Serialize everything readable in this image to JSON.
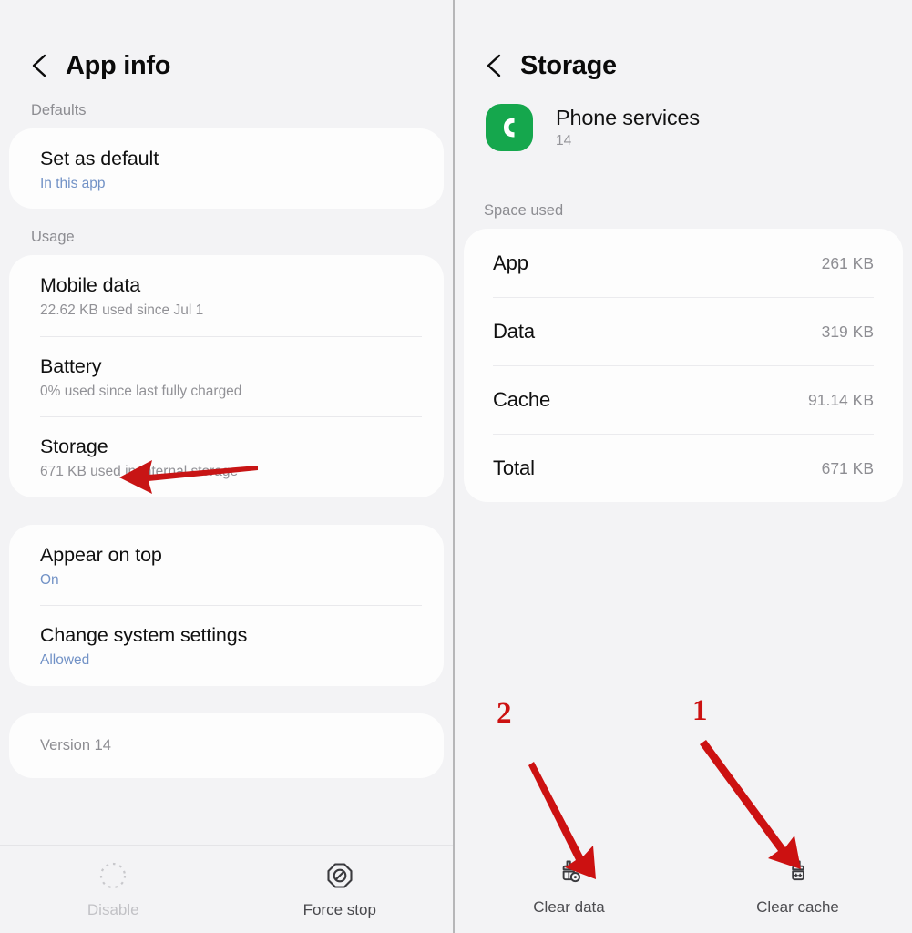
{
  "left_panel": {
    "header": {
      "title": "App info",
      "back_icon": "chevron-left-icon"
    },
    "sections": [
      {
        "label": "Defaults"
      },
      {
        "label": "Usage"
      }
    ],
    "defaults_card": {
      "rows": [
        {
          "title": "Set as default",
          "subtitle": "In this app",
          "subtitle_accent": true
        }
      ]
    },
    "usage_card": {
      "rows": [
        {
          "title": "Mobile data",
          "subtitle": "22.62 KB used since Jul 1",
          "subtitle_accent": false
        },
        {
          "title": "Battery",
          "subtitle": "0% used since last fully charged",
          "subtitle_accent": false
        },
        {
          "title": "Storage",
          "subtitle": "671 KB used in Internal storage",
          "subtitle_accent": false
        }
      ]
    },
    "permissions_card": {
      "rows": [
        {
          "title": "Appear on top",
          "subtitle": "On",
          "subtitle_accent": true
        },
        {
          "title": "Change system settings",
          "subtitle": "Allowed",
          "subtitle_accent": true
        }
      ]
    },
    "version_card": {
      "text": "Version 14"
    },
    "action_bar": [
      {
        "label": "Disable",
        "icon": "disable-dashed-circle-icon",
        "enabled": false
      },
      {
        "label": "Force stop",
        "icon": "force-stop-octagon-icon",
        "enabled": true
      }
    ]
  },
  "right_panel": {
    "header": {
      "title": "Storage",
      "back_icon": "chevron-left-icon"
    },
    "app": {
      "name": "Phone services",
      "version": "14",
      "icon_name": "phone-handset-icon",
      "icon_color": "#15a74d"
    },
    "space_used_label": "Space used",
    "storage_rows": [
      {
        "key": "App",
        "value": "261 KB"
      },
      {
        "key": "Data",
        "value": "319 KB"
      },
      {
        "key": "Cache",
        "value": "91.14 KB"
      },
      {
        "key": "Total",
        "value": "671 KB"
      }
    ],
    "clear_buttons": [
      {
        "label": "Clear data",
        "icon": "broom-data-icon"
      },
      {
        "label": "Clear cache",
        "icon": "broom-cache-icon"
      }
    ]
  },
  "annotations": {
    "accent_color": "#cc1111",
    "markers": [
      {
        "number": "2",
        "target": "clear-data-button"
      },
      {
        "number": "1",
        "target": "clear-cache-button"
      }
    ],
    "arrows": [
      {
        "name": "storage-row-arrow",
        "direction": "left"
      },
      {
        "name": "clear-data-arrow",
        "direction": "down-right"
      },
      {
        "name": "clear-cache-arrow",
        "direction": "down-right"
      }
    ]
  }
}
